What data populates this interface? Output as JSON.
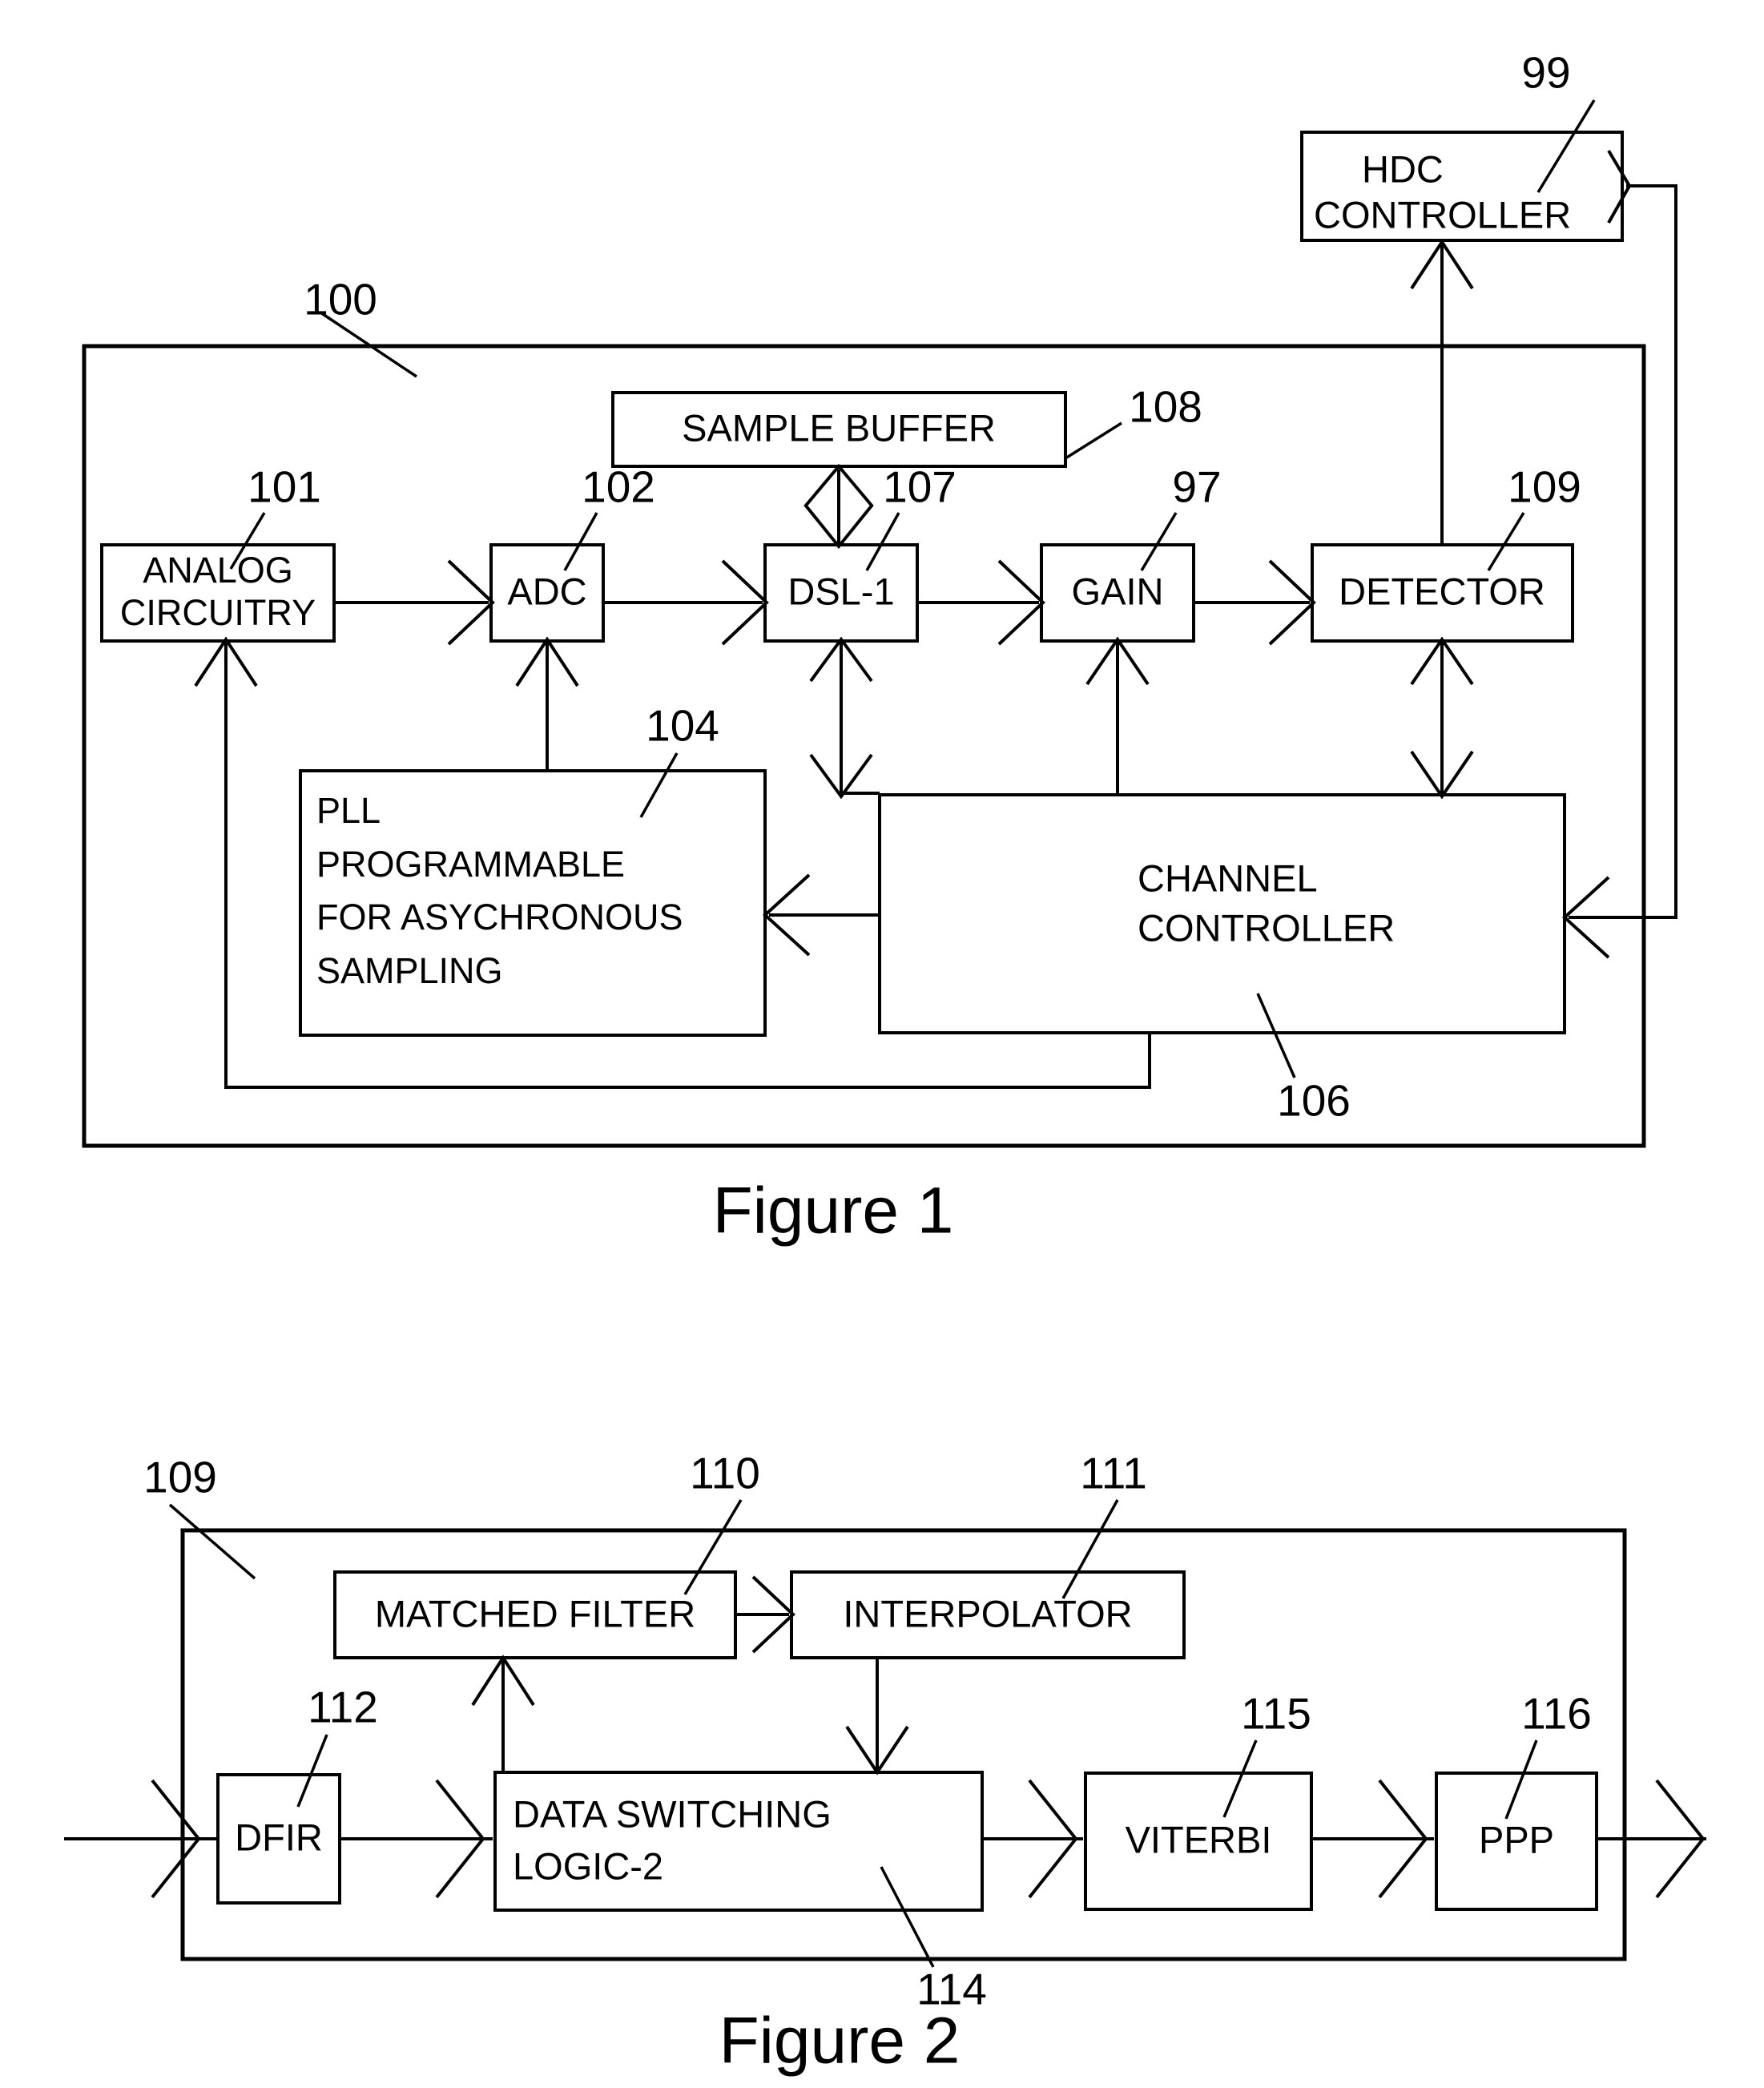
{
  "document": {
    "type": "patent-block-diagram",
    "figures": [
      {
        "caption": "Figure 1",
        "outer_ref": "100",
        "blocks": [
          {
            "id": "hdc",
            "label_lines": [
              "HDC",
              "CONTROLLER"
            ],
            "ref": "99"
          },
          {
            "id": "sample",
            "label_lines": [
              "SAMPLE BUFFER"
            ],
            "ref": "108"
          },
          {
            "id": "analog",
            "label_lines": [
              "ANALOG",
              "CIRCUITRY"
            ],
            "ref": "101"
          },
          {
            "id": "adc",
            "label_lines": [
              "ADC"
            ],
            "ref": "102"
          },
          {
            "id": "dsl1",
            "label_lines": [
              "DSL-1"
            ],
            "ref": "107"
          },
          {
            "id": "gain",
            "label_lines": [
              "GAIN"
            ],
            "ref": "97"
          },
          {
            "id": "detector",
            "label_lines": [
              "DETECTOR"
            ],
            "ref": "109"
          },
          {
            "id": "pll",
            "label_lines": [
              "PLL",
              "PROGRAMMABLE",
              "FOR ASYCHRONOUS",
              "SAMPLING"
            ],
            "ref": "104"
          },
          {
            "id": "channel",
            "label_lines": [
              "CHANNEL",
              "CONTROLLER"
            ],
            "ref": "106"
          }
        ]
      },
      {
        "caption": "Figure 2",
        "outer_ref": "109",
        "blocks": [
          {
            "id": "matched",
            "label_lines": [
              "MATCHED FILTER"
            ],
            "ref": "110"
          },
          {
            "id": "interp",
            "label_lines": [
              "INTERPOLATOR"
            ],
            "ref": "111"
          },
          {
            "id": "dfir",
            "label_lines": [
              "DFIR"
            ],
            "ref": "112"
          },
          {
            "id": "dsl2",
            "label_lines": [
              "DATA SWITCHING",
              "LOGIC-2"
            ],
            "ref": "114"
          },
          {
            "id": "viterbi",
            "label_lines": [
              "VITERBI"
            ],
            "ref": "115"
          },
          {
            "id": "ppp",
            "label_lines": [
              "PPP"
            ],
            "ref": "116"
          }
        ]
      }
    ]
  },
  "fig1": {
    "caption": "Figure 1",
    "ref_100": "100",
    "ref_99": "99",
    "ref_108": "108",
    "ref_101": "101",
    "ref_102": "102",
    "ref_107": "107",
    "ref_97": "97",
    "ref_109": "109",
    "ref_104": "104",
    "ref_106": "106",
    "hdc_line1": "HDC",
    "hdc_line2": "CONTROLLER",
    "sample_buffer": "SAMPLE BUFFER",
    "analog_line1": "ANALOG",
    "analog_line2": "CIRCUITRY",
    "adc": "ADC",
    "dsl1": "DSL-1",
    "gain": "GAIN",
    "detector": "DETECTOR",
    "pll_line1": "PLL",
    "pll_line2": "PROGRAMMABLE",
    "pll_line3": "FOR ASYCHRONOUS",
    "pll_line4": "SAMPLING",
    "channel_line1": "CHANNEL",
    "channel_line2": "CONTROLLER"
  },
  "fig2": {
    "caption": "Figure 2",
    "ref_109": "109",
    "ref_110": "110",
    "ref_111": "111",
    "ref_112": "112",
    "ref_114": "114",
    "ref_115": "115",
    "ref_116": "116",
    "matched_filter": "MATCHED FILTER",
    "interpolator": "INTERPOLATOR",
    "dfir": "DFIR",
    "dsl2_line1": "DATA SWITCHING",
    "dsl2_line2": "LOGIC-2",
    "viterbi": "VITERBI",
    "ppp": "PPP"
  },
  "colors": {
    "ink": "#000000",
    "paper": "#ffffff"
  }
}
